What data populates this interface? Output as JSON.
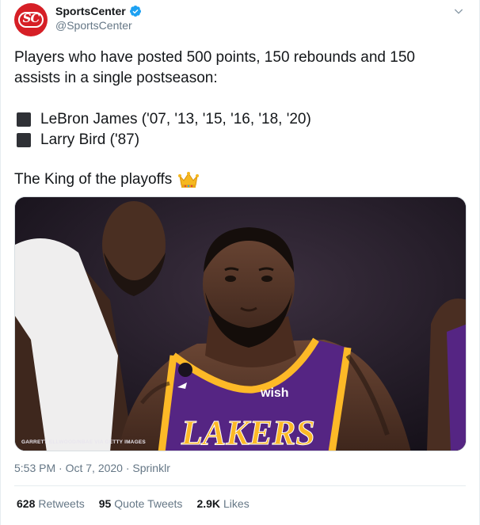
{
  "account": {
    "name": "SportsCenter",
    "handle": "@SportsCenter",
    "avatar_text": "SC",
    "verified_icon": "verified-badge-icon"
  },
  "tweet": {
    "intro": "Players who have posted 500 points, 150 rebounds and 150 assists in a single postseason:",
    "list": [
      "LeBron James ('07, '13, '15, '16, '18, '20)",
      "Larry Bird ('87)"
    ],
    "closing": "The King of the playoffs",
    "emoji": "crown-icon",
    "photo_credit": "GARRETT ELLWOOD/NBAE VIA GETTY IMAGES",
    "photo_jersey_text": "LAKERS",
    "photo_patch_text": "wish"
  },
  "meta": {
    "timestamp": "5:53 PM · Oct 7, 2020 · Sprinklr"
  },
  "stats": {
    "retweets_count": "628",
    "retweets_label": "Retweets",
    "quotes_count": "95",
    "quotes_label": "Quote Tweets",
    "likes_count": "2.9K",
    "likes_label": "Likes"
  },
  "colors": {
    "brand_red": "#d61f26",
    "verified_blue": "#1da1f2",
    "text": "#14171a",
    "muted": "#657786",
    "lakers_purple": "#552583",
    "lakers_gold": "#fdb927"
  }
}
